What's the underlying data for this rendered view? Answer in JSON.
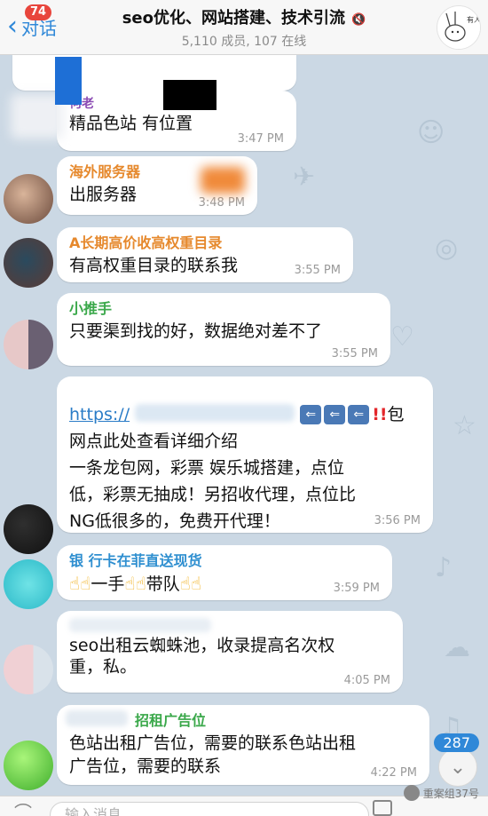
{
  "header": {
    "back_label": "对话",
    "back_badge": "74",
    "title": "seo优化、网站搭建、技术引流",
    "subtitle": "5,110 成员, 107 在线",
    "group_avatar_text": "有人在吗?"
  },
  "messages": [
    {
      "sender": "何老",
      "text": "精品色站  有位置",
      "time": "3:47 PM",
      "sender_color": "#8b4bb3"
    },
    {
      "sender": "海外服务器",
      "text": "出服务器",
      "time": "3:48 PM",
      "sender_color": "#e6892d"
    },
    {
      "sender": "A长期高价收高权重目录",
      "text": "有高权重目录的联系我",
      "time": "3:55 PM",
      "sender_color": "#e6892d"
    },
    {
      "sender": "小推手",
      "text": "只要渠到找的好，数据绝对差不了",
      "time": "3:55 PM",
      "sender_color": "#3aa84a"
    },
    {
      "sender": "",
      "link_text": "https://",
      "line1_suffix": "包",
      "lines": [
        "网点此处查看详细介绍",
        "一条龙包网，彩票 娱乐城搭建，点位",
        "低，彩票无抽成！另招收代理，点位比",
        "NG低很多的，免费开代理！"
      ],
      "time": "3:56 PM"
    },
    {
      "sender": "银 行卡在菲直送现货",
      "text_parts": [
        "一手",
        "带队"
      ],
      "time": "3:59 PM",
      "sender_color": "#2f8fd0"
    },
    {
      "sender": "",
      "lines": [
        "seo出租云蜘蛛池，收录提高名次权",
        "重，私。"
      ],
      "time": "4:05 PM"
    },
    {
      "sender": "招租广告位",
      "lines": [
        "色站出租广告位，需要的联系色站出租",
        "广告位，需要的联系"
      ],
      "time": "4:22 PM",
      "sender_color": "#3aa84a"
    }
  ],
  "unread_count": "287",
  "input": {
    "placeholder": "输入消息"
  },
  "watermark": "重案组37号"
}
